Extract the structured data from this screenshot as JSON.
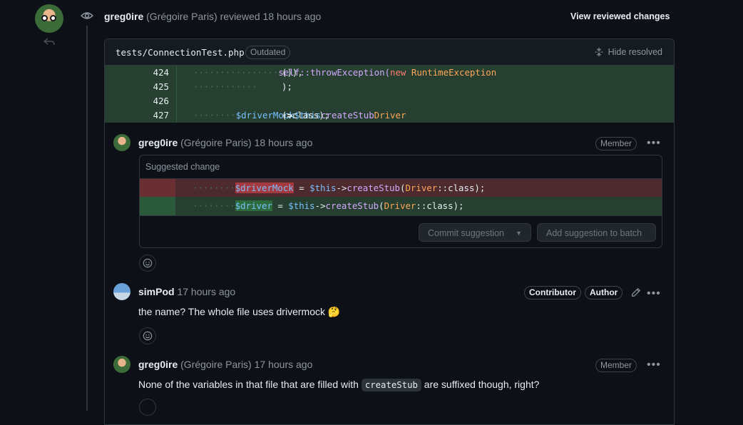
{
  "review": {
    "author": "greg0ire",
    "full_name": "(Grégoire Paris)",
    "action": "reviewed",
    "time": "18 hours ago",
    "view_changes_label": "View reviewed changes"
  },
  "file": {
    "path": "tests/ConnectionTest.php",
    "status_badge": "Outdated",
    "hide_resolved_label": "Hide resolved",
    "lines": [
      {
        "num": "424",
        "indent": "················",
        "code": [
          [
            "fn",
            "self::throwException("
          ],
          [
            "kw",
            "new "
          ],
          [
            "cls",
            "RuntimeException"
          ],
          [
            "txt",
            "()),"
          ]
        ]
      },
      {
        "num": "425",
        "indent": "············",
        "code": [
          [
            "txt",
            ");"
          ]
        ]
      },
      {
        "num": "426",
        "indent": "",
        "code": []
      },
      {
        "num": "427",
        "indent": "········",
        "code": [
          [
            "var",
            "$driverMock"
          ],
          [
            "txt",
            " = "
          ],
          [
            "var",
            "$this"
          ],
          [
            "txt",
            "->"
          ],
          [
            "fn",
            "createStub"
          ],
          [
            "txt",
            "("
          ],
          [
            "cls",
            "Driver"
          ],
          [
            "txt",
            "::class);"
          ]
        ]
      }
    ]
  },
  "comments": [
    {
      "author": "greg0ire",
      "full_name": "(Grégoire Paris)",
      "time": "18 hours ago",
      "badge": "Member",
      "suggestion": {
        "title": "Suggested change",
        "deleted_line": "$driverMock = $this->createStub(Driver::class);",
        "added_line": "$driver = $this->createStub(Driver::class);",
        "commit_label": "Commit suggestion",
        "batch_label": "Add suggestion to batch"
      }
    },
    {
      "author": "simPod",
      "time": "17 hours ago",
      "badges": [
        "Contributor",
        "Author"
      ],
      "body": "the name? The whole file uses drivermock",
      "emoji": "🤔"
    },
    {
      "author": "greg0ire",
      "full_name": "(Grégoire Paris)",
      "time": "17 hours ago",
      "badge": "Member",
      "body_before": "None of the variables in that file that are filled with",
      "body_code": "createStub",
      "body_after": "are suffixed though, right?"
    }
  ],
  "colors": {
    "background": "#0d1117",
    "added_line": "#263f31",
    "deleted_line": "#4c2a2d",
    "border": "#30363d"
  }
}
